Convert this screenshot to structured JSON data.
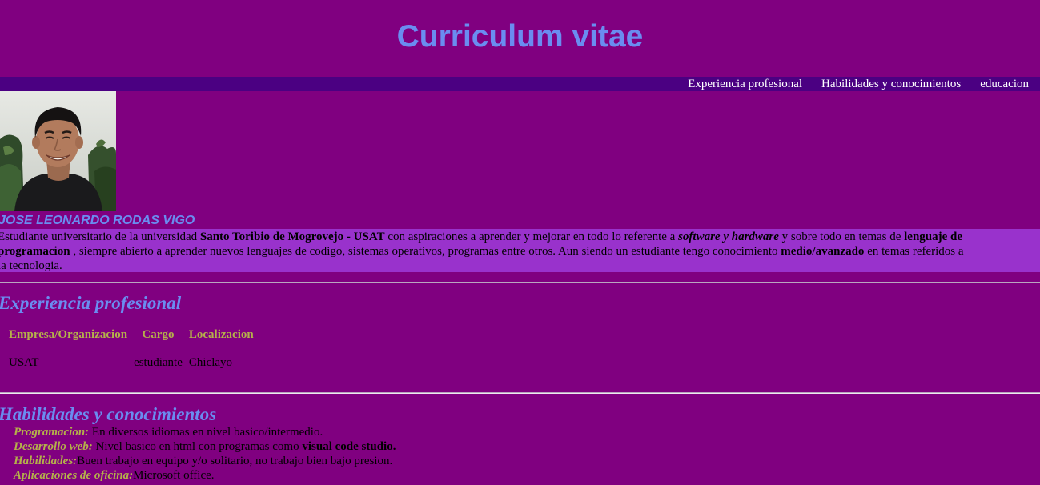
{
  "header": {
    "title": "Curriculum vitae"
  },
  "nav": {
    "items": [
      "Experiencia profesional",
      "Habilidades y conocimientos",
      "educacion"
    ]
  },
  "profile": {
    "name": "JOSE LEONARDO RODAS VIGO",
    "bio": {
      "t1": "Estudiante universitario de la universidad ",
      "b1": "Santo Toribio de Mogrovejo - USAT",
      "t2": " con aspiraciones a aprender y mejorar en todo lo referente a ",
      "bi1": "software y hardware",
      "t3": " y sobre todo en temas de ",
      "b2": "lenguaje de programacion",
      "t4": " , siempre abierto a aprender nuevos lenguajes de codigo, sistemas operativos, programas entre otros. Aun siendo un estudiante tengo conocimiento ",
      "b3": "medio/avanzado",
      "t5": " en temas referidos a la tecnologia."
    }
  },
  "experience": {
    "title": "Experiencia profesional",
    "columns": [
      "Empresa/Organizacion",
      "Cargo",
      "Localizacion"
    ],
    "rows": [
      [
        "USAT",
        "estudiante",
        "Chiclayo"
      ]
    ]
  },
  "skills": {
    "title": "Habilidades y conocimientos",
    "items": [
      {
        "label": "Programacion:",
        "text": " En diversos idiomas en nivel basico/intermedio."
      },
      {
        "label": "Desarrollo web:",
        "text": " Nivel basico en html con programas como ",
        "bold": "visual code studio."
      },
      {
        "label": "Habilidades:",
        "text": "Buen trabajo en equipo y/o solitario, no trabajo bien bajo presion."
      },
      {
        "label": "Aplicaciones de oficina:",
        "text": "Microsoft office."
      }
    ]
  },
  "colors": {
    "background": "#800080",
    "navbar": "#4b0082",
    "bio_band": "#9932cc",
    "heading": "#6a8cf0",
    "accent_olive": "#b5b14a"
  }
}
